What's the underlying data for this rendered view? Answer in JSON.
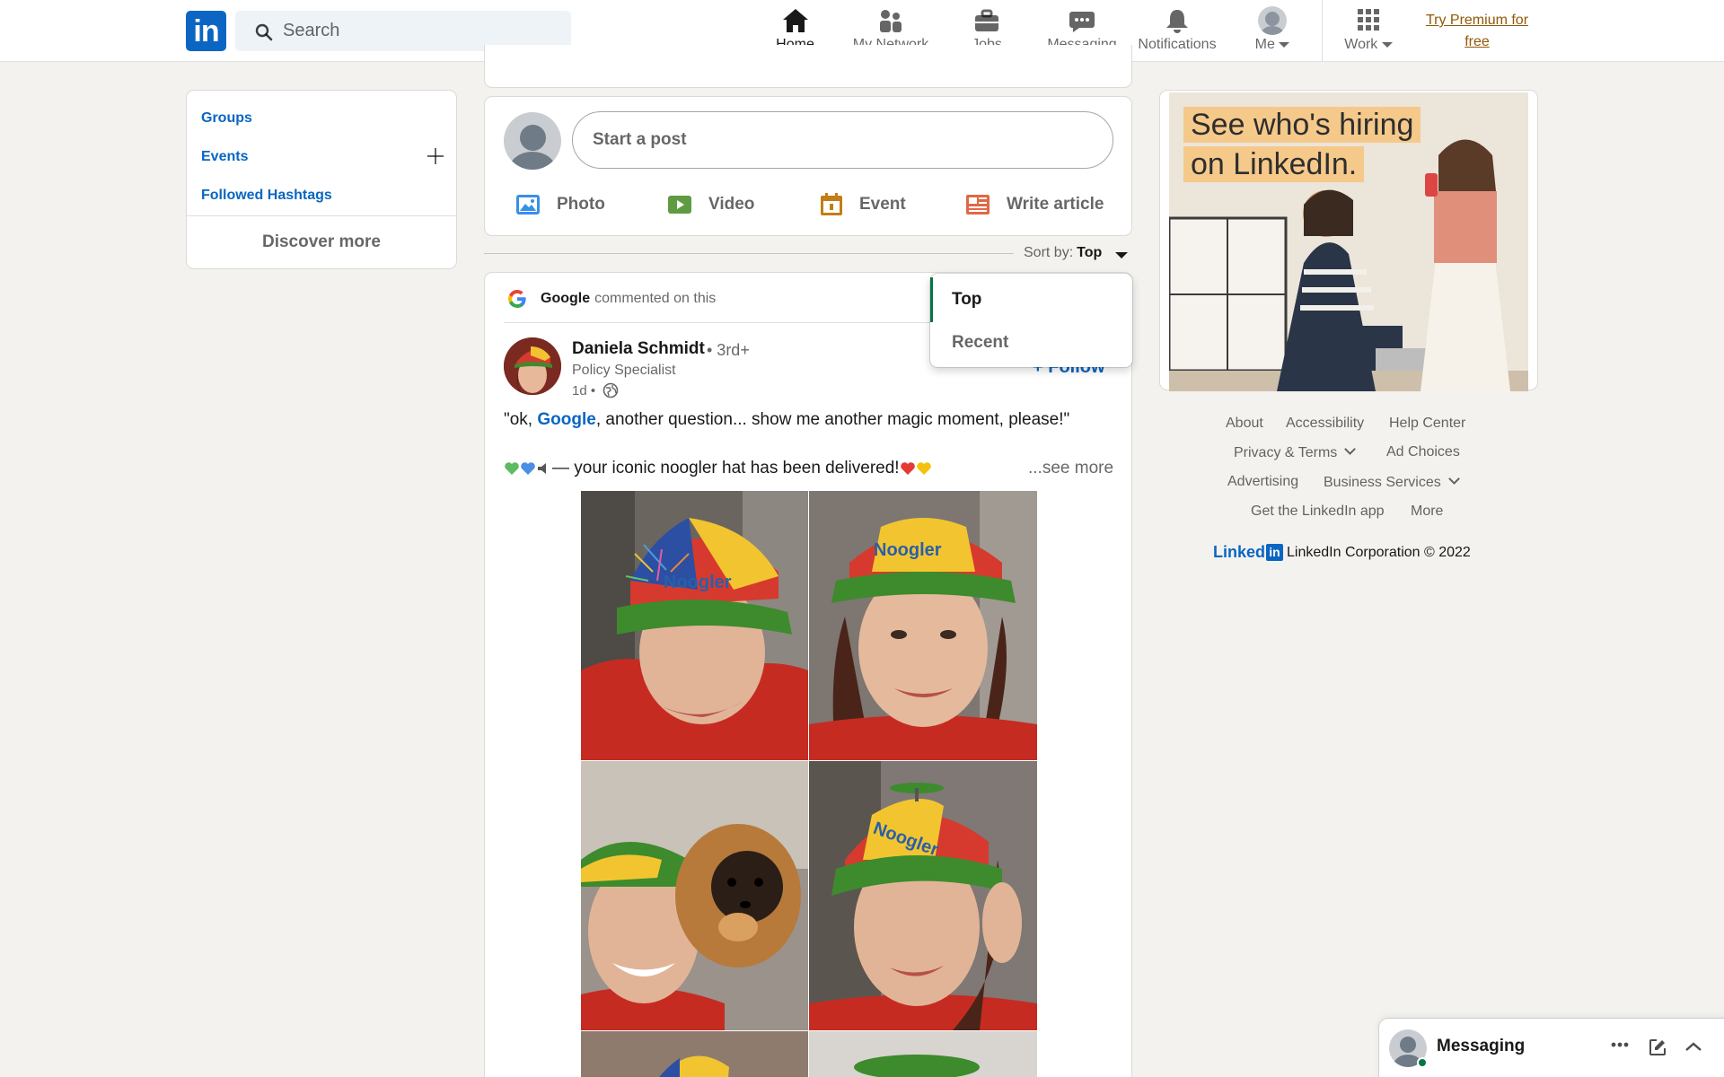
{
  "nav": {
    "logo": "in",
    "search_placeholder": "Search",
    "items": [
      {
        "label": "Home",
        "icon": "home-icon"
      },
      {
        "label": "My Network",
        "icon": "network-icon"
      },
      {
        "label": "Jobs",
        "icon": "briefcase-icon"
      },
      {
        "label": "Messaging",
        "icon": "chat-icon"
      },
      {
        "label": "Notifications",
        "icon": "bell-icon"
      },
      {
        "label": "Me",
        "icon": "avatar"
      },
      {
        "label": "Work",
        "icon": "grid-icon"
      }
    ],
    "premium_line1": "Try Premium for",
    "premium_line2": "free"
  },
  "left": {
    "groups": "Groups",
    "events": "Events",
    "hashtags": "Followed Hashtags",
    "discover": "Discover more"
  },
  "share": {
    "placeholder": "Start a post",
    "photo": "Photo",
    "video": "Video",
    "event": "Event",
    "article": "Write article"
  },
  "sort": {
    "label": "Sort by:",
    "value": "Top",
    "options": [
      "Top",
      "Recent"
    ]
  },
  "post": {
    "context_name": "Google",
    "context_action": "commented on this",
    "author": "Daniela Schmidt",
    "degree": "• 3rd+",
    "title": "Policy Specialist",
    "time": "1d •",
    "follow": "+ Follow",
    "text_pre": "\"ok, ",
    "text_link": "Google",
    "text_post": ", another question... show me another magic moment, please!\"",
    "text2": " — your iconic noogler hat has been delivered! ",
    "see_more": "...see more",
    "hat_text": "Noogler"
  },
  "ad": {
    "line1": "See who's hiring",
    "line2": "on LinkedIn."
  },
  "footer": {
    "about": "About",
    "accessibility": "Accessibility",
    "help": "Help Center",
    "privacy": "Privacy & Terms",
    "adchoices": "Ad Choices",
    "advertising": "Advertising",
    "business": "Business Services",
    "getapp": "Get the LinkedIn app",
    "more": "More",
    "brand_word": "Linked",
    "brand_box": "in",
    "corp": "LinkedIn Corporation © 2022"
  },
  "messaging": {
    "title": "Messaging"
  },
  "colors": {
    "brand": "#0a66c2",
    "premium": "#915907",
    "active_green": "#057642"
  }
}
